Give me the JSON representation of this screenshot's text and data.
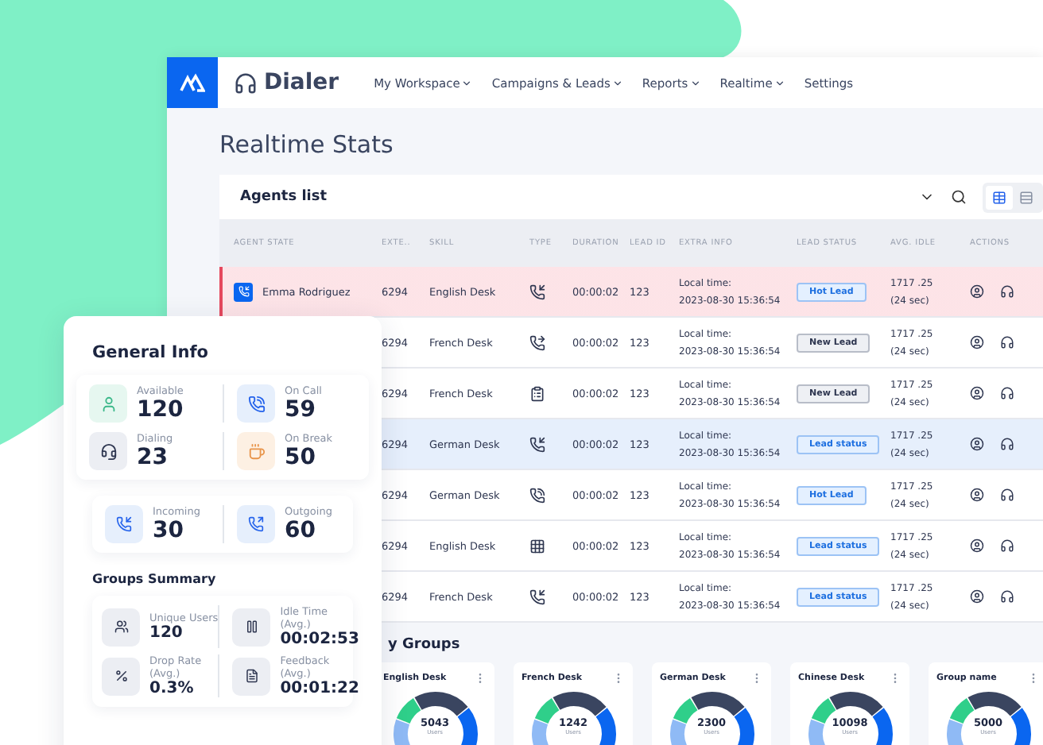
{
  "app": {
    "name": "Dialer"
  },
  "nav": [
    {
      "label": "My Workspace",
      "dropdown": true
    },
    {
      "label": "Campaigns & Leads",
      "dropdown": true
    },
    {
      "label": "Reports",
      "dropdown": true
    },
    {
      "label": "Realtime",
      "dropdown": true
    },
    {
      "label": "Settings",
      "dropdown": false
    }
  ],
  "page_title": "Realtime Stats",
  "agents_list": {
    "title": "Agents list",
    "views": [
      {
        "kind": "table",
        "selected": true
      },
      {
        "kind": "list",
        "selected": false
      }
    ],
    "columns": [
      "AGENT STATE",
      "EXTE..",
      "SKILL",
      "TYPE",
      "DURATION",
      "LEAD ID",
      "EXTRA INFO",
      "LEAD STATUS",
      "AVG. IDLE",
      "ACTIONS"
    ],
    "rows": [
      {
        "alert": true,
        "selected": false,
        "agent": "Emma Rodriguez",
        "extension": "6294",
        "skill": "English Desk",
        "type_icon": {
          "kind": "incoming"
        },
        "duration": "00:00:02",
        "lead_id": "123",
        "info_label": "Local time:",
        "info_time": "2023-08-30 15:36:54",
        "lead_status": {
          "label": "Hot Lead",
          "kind": "hot"
        },
        "idle": "1717 .25",
        "idle_sub": "(24 sec)"
      },
      {
        "alert": false,
        "selected": false,
        "extension": "6294",
        "skill": "French Desk",
        "type_icon": {
          "kind": "transfer"
        },
        "duration": "00:00:02",
        "lead_id": "123",
        "info_label": "Local time:",
        "info_time": "2023-08-30 15:36:54",
        "lead_status": {
          "label": "New Lead",
          "kind": "new"
        },
        "idle": "1717 .25",
        "idle_sub": "(24 sec)"
      },
      {
        "alert": false,
        "selected": false,
        "extension": "6294",
        "skill": "French Desk",
        "type_icon": {
          "kind": "form"
        },
        "duration": "00:00:02",
        "lead_id": "123",
        "info_label": "Local time:",
        "info_time": "2023-08-30 15:36:54",
        "lead_status": {
          "label": "New Lead",
          "kind": "new"
        },
        "idle": "1717 .25",
        "idle_sub": "(24 sec)"
      },
      {
        "alert": false,
        "selected": true,
        "extension": "6294",
        "skill": "German Desk",
        "type_icon": {
          "kind": "incoming"
        },
        "duration": "00:00:02",
        "lead_id": "123",
        "info_label": "Local time:",
        "info_time": "2023-08-30 15:36:54",
        "lead_status": {
          "label": "Lead status",
          "kind": "status"
        },
        "idle": "1717 .25",
        "idle_sub": "(24 sec)"
      },
      {
        "alert": false,
        "selected": false,
        "extension": "6294",
        "skill": "German Desk",
        "type_icon": {
          "kind": "add"
        },
        "duration": "00:00:02",
        "lead_id": "123",
        "info_label": "Local time:",
        "info_time": "2023-08-30 15:36:54",
        "lead_status": {
          "label": "Hot Lead",
          "kind": "hot"
        },
        "idle": "1717 .25",
        "idle_sub": "(24 sec)"
      },
      {
        "alert": false,
        "selected": false,
        "extension": "6294",
        "skill": "English Desk",
        "type_icon": {
          "kind": "dialpad"
        },
        "duration": "00:00:02",
        "lead_id": "123",
        "info_label": "Local time:",
        "info_time": "2023-08-30 15:36:54",
        "lead_status": {
          "label": "Lead status",
          "kind": "status"
        },
        "idle": "1717 .25",
        "idle_sub": "(24 sec)"
      },
      {
        "alert": false,
        "selected": false,
        "extension": "6294",
        "skill": "French Desk",
        "type_icon": {
          "kind": "incoming"
        },
        "duration": "00:00:02",
        "lead_id": "123",
        "info_label": "Local time:",
        "info_time": "2023-08-30 15:36:54",
        "lead_status": {
          "label": "Lead status",
          "kind": "status"
        },
        "idle": "1717 .25",
        "idle_sub": "(24 sec)"
      }
    ]
  },
  "groups_section": {
    "title": "y Groups",
    "groups": [
      {
        "name": "English Desk",
        "total": "5043",
        "unit": "Users"
      },
      {
        "name": "French Desk",
        "total": "1242",
        "unit": "Users"
      },
      {
        "name": "German Desk",
        "total": "2300",
        "unit": "Users"
      },
      {
        "name": "Chinese Desk",
        "total": "10098",
        "unit": "Users"
      },
      {
        "name": "Group name",
        "total": "5000",
        "unit": "Users"
      }
    ]
  },
  "general_info": {
    "title": "General Info",
    "stats": [
      {
        "kind": "available",
        "label": "Available",
        "value": "120"
      },
      {
        "kind": "on_call",
        "label": "On Call",
        "value": "59"
      },
      {
        "kind": "dialing",
        "label": "Dialing",
        "value": "23"
      },
      {
        "kind": "on_break",
        "label": "On Break",
        "value": "50"
      }
    ],
    "calls": [
      {
        "kind": "incoming",
        "label": "Incoming",
        "value": "30"
      },
      {
        "kind": "outgoing",
        "label": "Outgoing",
        "value": "60"
      }
    ]
  },
  "groups_summary": {
    "title": "Groups Summary",
    "items": [
      {
        "kind": "users",
        "label": "Unique Users",
        "value": "120"
      },
      {
        "kind": "drop",
        "label": "Drop Rate",
        "sub": "(Avg.)",
        "value": "0.3%"
      },
      {
        "kind": "idle",
        "label": "Idle Time",
        "sub": "(Avg.)",
        "value": "00:02:53"
      },
      {
        "kind": "feedback",
        "label": "Feedback",
        "sub": "(Avg.)",
        "value": "00:01:22"
      }
    ]
  }
}
